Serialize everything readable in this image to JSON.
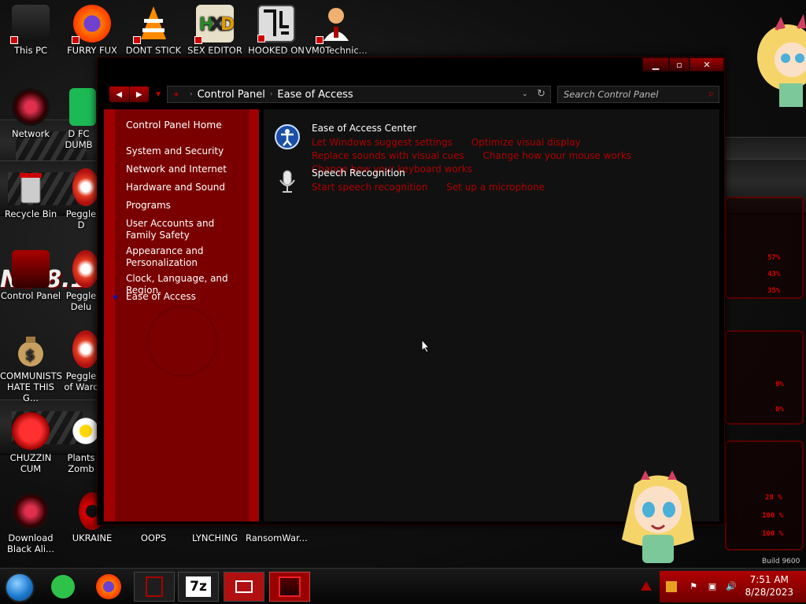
{
  "desktop": {
    "icons": [
      {
        "label": "This PC"
      },
      {
        "label": "FURRY FUX"
      },
      {
        "label": "DONT STICK"
      },
      {
        "label": "SEX EDITOR"
      },
      {
        "label": "HOOKED ON"
      },
      {
        "label": "VM0Technic..."
      },
      {
        "label": "Network"
      },
      {
        "label": "D FC DUMB"
      },
      {
        "label": "Recycle Bin"
      },
      {
        "label": "Peggle D"
      },
      {
        "label": "Control Panel"
      },
      {
        "label": "Peggle Delu"
      },
      {
        "label": "COMMUNISTS HATE THIS G..."
      },
      {
        "label": "Peggle of Warc"
      },
      {
        "label": "CHUZZIN CUM"
      },
      {
        "label": "Plants Zomb"
      },
      {
        "label": "Download Black Ali..."
      },
      {
        "label": "UKRAINE"
      },
      {
        "label": "OOPS"
      },
      {
        "label": "LYNCHING"
      },
      {
        "label": "RansomWar..."
      }
    ],
    "wallpaper_text": "NS 8.1",
    "hud_values": [
      "57%",
      "43%",
      "35%",
      "0%",
      "0%",
      "28 %",
      "100 %",
      "100 %"
    ],
    "build_text": "Build 9600"
  },
  "window": {
    "breadcrumb": [
      "Control Panel",
      "Ease of Access"
    ],
    "search_placeholder": "Search Control Panel",
    "sidebar": {
      "home": "Control Panel Home",
      "items": [
        "System and Security",
        "Network and Internet",
        "Hardware and Sound",
        "Programs",
        "User Accounts and Family Safety",
        "Appearance and Personalization",
        "Clock, Language, and Region",
        "Ease of Access"
      ],
      "current": "Ease of Access"
    },
    "tasks": [
      {
        "title": "Ease of Access Center",
        "icon": "ease-of-access-icon",
        "links": [
          "Let Windows suggest settings",
          "Optimize visual display",
          "Replace sounds with visual cues",
          "Change how your mouse works",
          "Change how your keyboard works"
        ]
      },
      {
        "title": "Speech Recognition",
        "icon": "microphone-icon",
        "links": [
          "Start speech recognition",
          "Set up a microphone"
        ]
      }
    ]
  },
  "taskbar": {
    "time": "7:51 AM",
    "date": "8/28/2023",
    "apps": [
      "start-orb",
      "feather-app",
      "firefox",
      "control-panel-app",
      "7-zip",
      "screen-app",
      "control-panel-active"
    ],
    "sevenzip_label": "7z"
  },
  "colors": {
    "accent": "#a00000",
    "sidebar": "#7a0000",
    "link": "#b00000"
  }
}
